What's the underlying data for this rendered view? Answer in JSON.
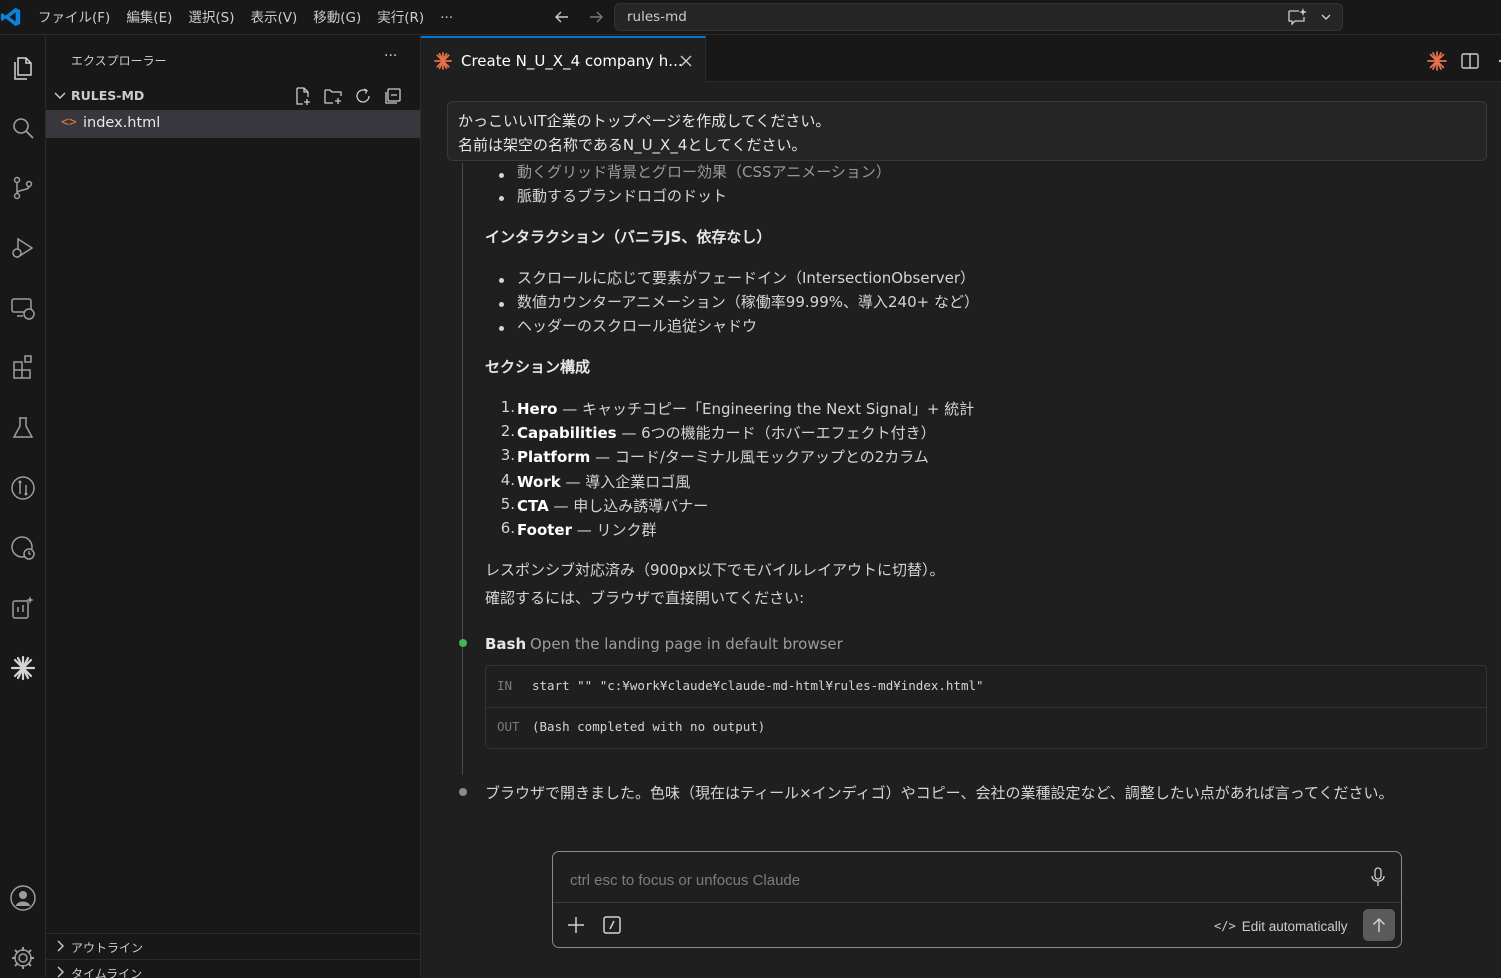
{
  "titlebar": {
    "menu": [
      "ファイル(F)",
      "編集(E)",
      "選択(S)",
      "表示(V)",
      "移動(G)",
      "実行(R)",
      "···"
    ],
    "command_center": "rules-md"
  },
  "colors": {
    "accent": "#0078d4",
    "claude": "#e8704a",
    "bash_dot": "#3fb950",
    "end_dot": "#8b8b8b"
  },
  "sidebar": {
    "title": "エクスプローラー",
    "more": "···",
    "folder": "RULES-MD",
    "file": {
      "icon": "<>",
      "name": "index.html"
    },
    "sections": [
      "アウトライン",
      "タイムライン"
    ]
  },
  "editor": {
    "tab_title": "Create N_U_X_4 company h...",
    "chat": {
      "user_message": {
        "line1": "かっこいいIT企業のトップページを作成してください。",
        "line2": "名前は架空の名称であるN_U_X_4としてください。"
      },
      "partial_bullet": "動くグリッド背景とグロー効果（CSSアニメーション）",
      "bullets_a": [
        "脈動するブランドロゴのドット"
      ],
      "heading_interaction": "インタラクション（バニラJS、依存なし）",
      "bullets_b": [
        "スクロールに応じて要素がフェードイン（IntersectionObserver）",
        "数値カウンターアニメーション（稼働率99.99%、導入240+ など）",
        "ヘッダーのスクロール追従シャドウ"
      ],
      "heading_sections": "セクション構成",
      "sections": [
        {
          "num": "1.",
          "name": "Hero",
          "desc": " — キャッチコピー「Engineering the Next Signal」+ 統計"
        },
        {
          "num": "2.",
          "name": "Capabilities",
          "desc": " — 6つの機能カード（ホバーエフェクト付き）"
        },
        {
          "num": "3.",
          "name": "Platform",
          "desc": " — コード/ターミナル風モックアップとの2カラム"
        },
        {
          "num": "4.",
          "name": "Work",
          "desc": " — 導入企業ロゴ風"
        },
        {
          "num": "5.",
          "name": "CTA",
          "desc": " — 申し込み誘導バナー"
        },
        {
          "num": "6.",
          "name": "Footer",
          "desc": " — リンク群"
        }
      ],
      "responsive_note": "レスポンシブ対応済み（900px以下でモバイルレイアウトに切替）。",
      "confirm_note": "確認するには、ブラウザで直接開いてください:",
      "bash": {
        "label": "Bash",
        "description": "Open the landing page in default browser",
        "in_label": "IN",
        "in_value": "start \"\" \"c:¥work¥claude¥claude-md-html¥rules-md¥index.html\"",
        "out_label": "OUT",
        "out_value": "(Bash completed with no output)"
      },
      "final_message": "ブラウザで開きました。色味（現在はティール×インディゴ）やコピー、会社の業種設定など、調整したい点があれば言ってください。"
    },
    "input": {
      "placeholder": "ctrl esc to focus or unfocus Claude",
      "edit_mode_icon": "</>",
      "edit_mode": "Edit automatically"
    }
  }
}
